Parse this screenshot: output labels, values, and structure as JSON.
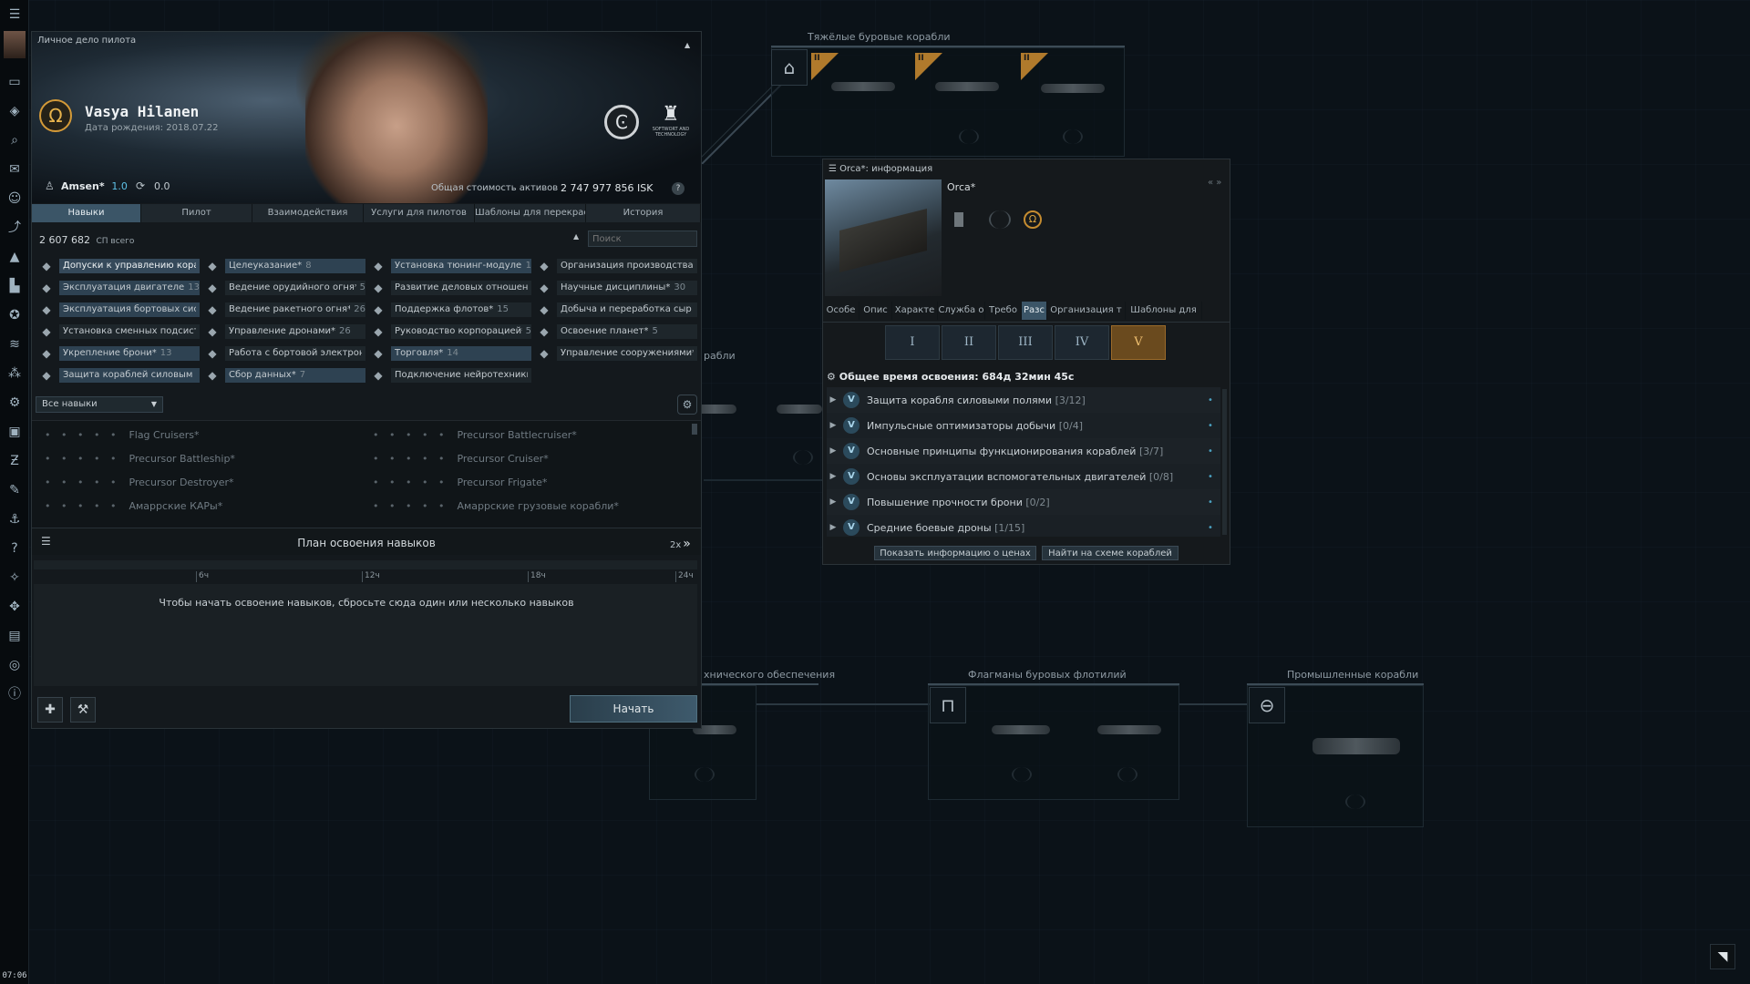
{
  "neocom": {
    "clock": "07:06",
    "icons": [
      "menu-icon",
      "avatar-icon",
      "chat-icon",
      "inventory-icon",
      "search-icon",
      "mail-icon",
      "people-icon",
      "market-icon",
      "fitting-icon",
      "industry-icon",
      "agency-icon",
      "skills-icon",
      "map-icon",
      "corp-icon",
      "assets-icon",
      "planets-icon",
      "contracts-icon",
      "fleet-icon",
      "help-icon",
      "achievements-icon",
      "structures-icon",
      "journal-icon",
      "scope-icon",
      "info-icon"
    ]
  },
  "ship_tree": {
    "group_heavy": "Тяжёлые буровые корабли",
    "group_support": "хнического обеспечения",
    "group_flagship": "Флагманы буровых флотилий",
    "group_industrial": "Промышленные корабли",
    "partial_label": "рабли",
    "tier_labels": [
      "II",
      "II",
      "II"
    ]
  },
  "charsheet": {
    "window_title": "Личное дело пилота",
    "name": "Vasya Hilanen",
    "birth": "Дата рождения: 2018.07.22",
    "corp_name": "Amsen*",
    "corp_standing": "1.0",
    "security": "0.0",
    "assets_label": "Общая стоимость активов",
    "assets_value": "2 747 977 856 ISK",
    "help": "?",
    "alliance_badge": "SOFTWORT AND TECHNOLOGY",
    "tabs": [
      "Навыки",
      "Пилот",
      "Взаимодействия",
      "Услуги для пилотов",
      "Шаблоны для перекрас",
      "История"
    ],
    "sp_total": "2 607 682",
    "sp_label": "СП всего",
    "search_placeholder": "Поиск",
    "skill_cols": [
      [
        {
          "label": "Допуски к управлению кора",
          "count": "",
          "style": "hl2"
        },
        {
          "label": "Эксплуатация двигателей*",
          "count": "13",
          "style": "hl"
        },
        {
          "label": "Эксплуатация бортовых сист",
          "count": "",
          "style": "hl"
        },
        {
          "label": "Установка сменных подсист",
          "count": "",
          "style": ""
        },
        {
          "label": "Укрепление брони*",
          "count": "13",
          "style": "hl"
        },
        {
          "label": "Защита кораблей силовым",
          "count": "",
          "style": "hl"
        }
      ],
      [
        {
          "label": "Целеуказание*",
          "count": "8",
          "style": "hl"
        },
        {
          "label": "Ведение орудийного огня*",
          "count": "5",
          "style": ""
        },
        {
          "label": "Ведение ракетного огня*",
          "count": "26",
          "style": ""
        },
        {
          "label": "Управление дронами*",
          "count": "26",
          "style": ""
        },
        {
          "label": "Работа с бортовой электрон",
          "count": "",
          "style": ""
        },
        {
          "label": "Сбор данных*",
          "count": "7",
          "style": "hl"
        }
      ],
      [
        {
          "label": "Установка тюнинг-модулей*",
          "count": "1",
          "style": "hl"
        },
        {
          "label": "Развитие деловых отношен",
          "count": "",
          "style": ""
        },
        {
          "label": "Поддержка флотов*",
          "count": "15",
          "style": ""
        },
        {
          "label": "Руководство корпорацией*",
          "count": "5",
          "style": ""
        },
        {
          "label": "Торговля*",
          "count": "14",
          "style": "hl"
        },
        {
          "label": "Подключение нейротехники*",
          "count": "",
          "style": ""
        }
      ],
      [
        {
          "label": "Организация производства*",
          "count": "",
          "style": ""
        },
        {
          "label": "Научные дисциплины*",
          "count": "30",
          "style": ""
        },
        {
          "label": "Добыча и переработка сыр",
          "count": "",
          "style": ""
        },
        {
          "label": "Освоение планет*",
          "count": "5",
          "style": ""
        },
        {
          "label": "Управление сооружениями*",
          "count": "",
          "style": ""
        }
      ]
    ],
    "skill_icons": [
      [
        "ship-icon",
        "engine-icon",
        "gear-icon",
        "subsystem-icon",
        "armor-icon",
        "shield-icon"
      ],
      [
        "target-icon",
        "gunnery-icon",
        "missile-icon",
        "drone-icon",
        "electronics-icon",
        "scanning-icon"
      ],
      [
        "rig-icon",
        "social-icon",
        "fleet-icon",
        "corp-icon",
        "trade-icon",
        "neural-icon"
      ],
      [
        "production-icon",
        "science-icon",
        "mining-icon",
        "planet-icon",
        "structure-icon"
      ]
    ],
    "filter": "Все навыки",
    "skillbooks_left": [
      "Flag Cruisers*",
      "Precursor Battleship*",
      "Precursor Destroyer*",
      "Амаррские КАРы*"
    ],
    "skillbooks_right": [
      "Precursor Battlecruiser*",
      "Precursor Cruiser*",
      "Precursor Frigate*",
      "Амаррские грузовые корабли*"
    ],
    "dots": "• • • • •",
    "queue_title": "План освоения навыков",
    "queue_speed": "2x",
    "timeline": [
      "6ч",
      "12ч",
      "18ч",
      "24ч"
    ],
    "queue_hint": "Чтобы начать освоение навыков, сбросьте сюда один или несколько навыков",
    "start_button": "Начать"
  },
  "orca": {
    "window_title": "Orca*: информация",
    "ship_name": "Orca*",
    "tabs": [
      "Особе",
      "Опис",
      "Характе",
      "Служба о",
      "Требо",
      "Разс",
      "Организация т",
      "Шаблоны для"
    ],
    "masteries": [
      "I",
      "II",
      "III",
      "IV",
      "V"
    ],
    "total_time_label": "Общее время освоения:",
    "total_time_value": "684д 32мин 45с",
    "certs": [
      {
        "label": "Защита корабля силовыми полями",
        "progress": "[3/12]"
      },
      {
        "label": "Импульсные оптимизаторы добычи",
        "progress": "[0/4]"
      },
      {
        "label": "Основные принципы функционирования кораблей",
        "progress": "[3/7]"
      },
      {
        "label": "Основы эксплуатации вспомогательных двигателей",
        "progress": "[0/8]"
      },
      {
        "label": "Повышение прочности брони",
        "progress": "[0/2]"
      },
      {
        "label": "Средние боевые дроны",
        "progress": "[1/15]"
      }
    ],
    "cert_icon": "V",
    "btn_prices": "Показать информацию о ценах",
    "btn_tree": "Найти на схеме кораблей"
  },
  "colors": {
    "accent": "#3b5567",
    "mastery_gold": "#b07a2c"
  }
}
